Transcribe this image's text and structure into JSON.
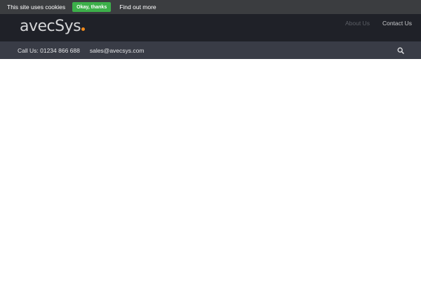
{
  "cookie_bar": {
    "message": "This site uses cookies",
    "accept_label": "Okay, thanks",
    "more_label": "Find out more",
    "accept_color": "#3cb04a"
  },
  "header": {
    "logo_text": "avecSys",
    "logo_dot_color": "#f08a1c",
    "nav": {
      "about_label": "About Us",
      "contact_label": "Contact Us"
    }
  },
  "contact_bar": {
    "phone_text": "Call Us: 01234 866 688",
    "email_text": "sales@avecsys.com",
    "search_icon": "search-icon"
  }
}
